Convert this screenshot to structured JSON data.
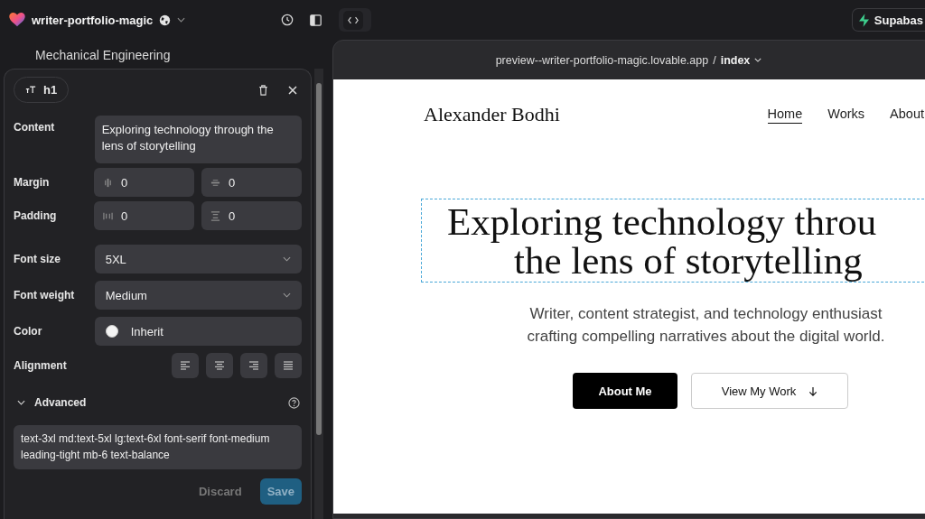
{
  "topbar": {
    "project": "writer-portfolio-magic",
    "supabase": "Supabas"
  },
  "chat": {
    "line": "Mechanical Engineering"
  },
  "editor": {
    "tag": "h1",
    "content": {
      "label": "Content",
      "value": "Exploring technology through the lens of storytelling"
    },
    "spacing": [
      {
        "label": "Margin",
        "fields": [
          {
            "kind": "x",
            "value": "0"
          },
          {
            "kind": "y",
            "value": "0"
          }
        ]
      },
      {
        "label": "Padding",
        "fields": [
          {
            "kind": "x",
            "value": "0"
          },
          {
            "kind": "y",
            "value": "0"
          }
        ]
      }
    ],
    "selects": [
      {
        "label": "Font size",
        "value": "5XL"
      },
      {
        "label": "Font weight",
        "value": "Medium"
      }
    ],
    "color": {
      "label": "Color",
      "value": "Inherit"
    },
    "alignment": {
      "label": "Alignment",
      "options": [
        {
          "kind": "left"
        },
        {
          "kind": "center"
        },
        {
          "kind": "right"
        },
        {
          "kind": "justify"
        }
      ]
    },
    "advanced": {
      "label": "Advanced",
      "expanded": true,
      "classes": "text-3xl md:text-5xl lg:text-6xl font-serif font-medium leading-tight mb-6 text-balance"
    },
    "buttons": {
      "discard": "Discard",
      "save": "Save"
    }
  },
  "preview": {
    "url": "preview--writer-portfolio-magic.lovable.app",
    "separator": "/",
    "page": "index",
    "site": {
      "brand": "Alexander Bodhi",
      "nav": [
        {
          "label": "Home",
          "selected": true
        },
        {
          "label": "Works",
          "selected": false
        },
        {
          "label": "About",
          "selected": false
        }
      ],
      "heading_lines": [
        "Exploring technology throu",
        "the lens of storytelling"
      ],
      "subtitle": "Writer, content strategist, and technology enthusiast crafting compelling narratives about the digital world.",
      "primary_button": "About Me",
      "secondary_button": "View My Work"
    }
  }
}
